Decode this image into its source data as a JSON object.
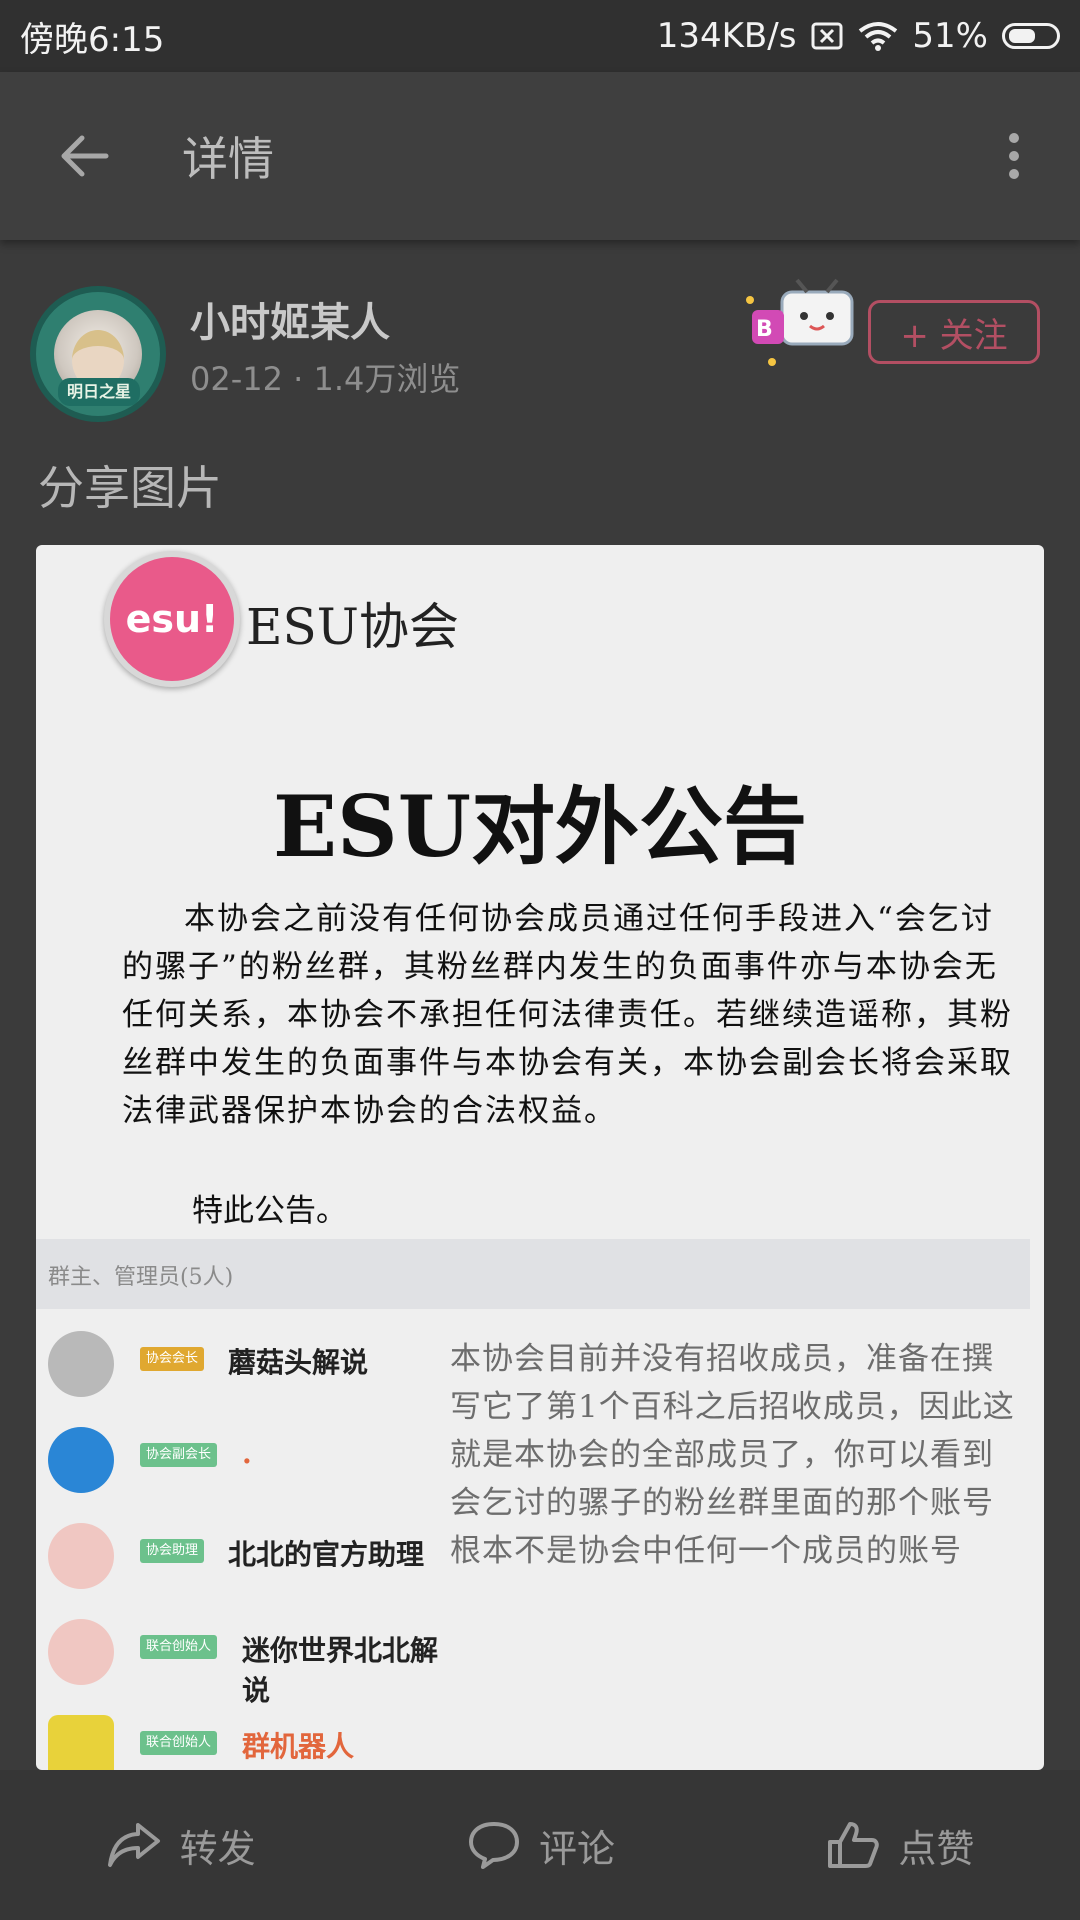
{
  "status": {
    "time": "傍晚6:15",
    "network_speed": "134KB/s",
    "battery": "51%"
  },
  "toolbar": {
    "title": "详情"
  },
  "author": {
    "name": "小时姬某人",
    "meta": "02-12 · 1.4万浏览",
    "avatar_badge": "明日之星",
    "follow_label": "+ 关注"
  },
  "post": {
    "caption": "分享图片"
  },
  "image": {
    "org_logo": "esu!",
    "org_name": "ESU协会",
    "title": "ESU对外公告",
    "body": "本协会之前没有任何协会成员通过任何手段进入“会乞讨的骡子”的粉丝群，其粉丝群内发生的负面事件亦与本协会无任何关系，本协会不承担任何法律责任。若继续造谣称，其粉丝群中发生的负面事件与本协会有关，本协会副会长将会采取法律武器保护本协会的合法权益。",
    "sign": "特此公告。",
    "group_header": "群主、管理员(5人)",
    "members": [
      {
        "tag": "协会会长",
        "name": "蘑菇头解说"
      },
      {
        "tag": "协会副会长",
        "name": "."
      },
      {
        "tag": "协会助理",
        "name": "北北的官方助理"
      },
      {
        "tag": "联合创始人",
        "name": "迷你世界北北解说"
      },
      {
        "tag": "联合创始人",
        "name": "群机器人"
      }
    ],
    "side_note": "本协会目前并没有招收成员，准备在撰写它了第1个百科之后招收成员，因此这就是本协会的全部成员了，你可以看到会乞讨的骡子的粉丝群里面的那个账号根本不是协会中任何一个成员的账号"
  },
  "actions": {
    "share": "转发",
    "comment": "评论",
    "like": "点赞"
  },
  "colors": {
    "follow_accent": "#b34f63",
    "esu_pink": "#e95a8a",
    "tag_yellow": "#e0a830",
    "tag_green": "#6cc18c",
    "robot_name": "#e2663c"
  }
}
